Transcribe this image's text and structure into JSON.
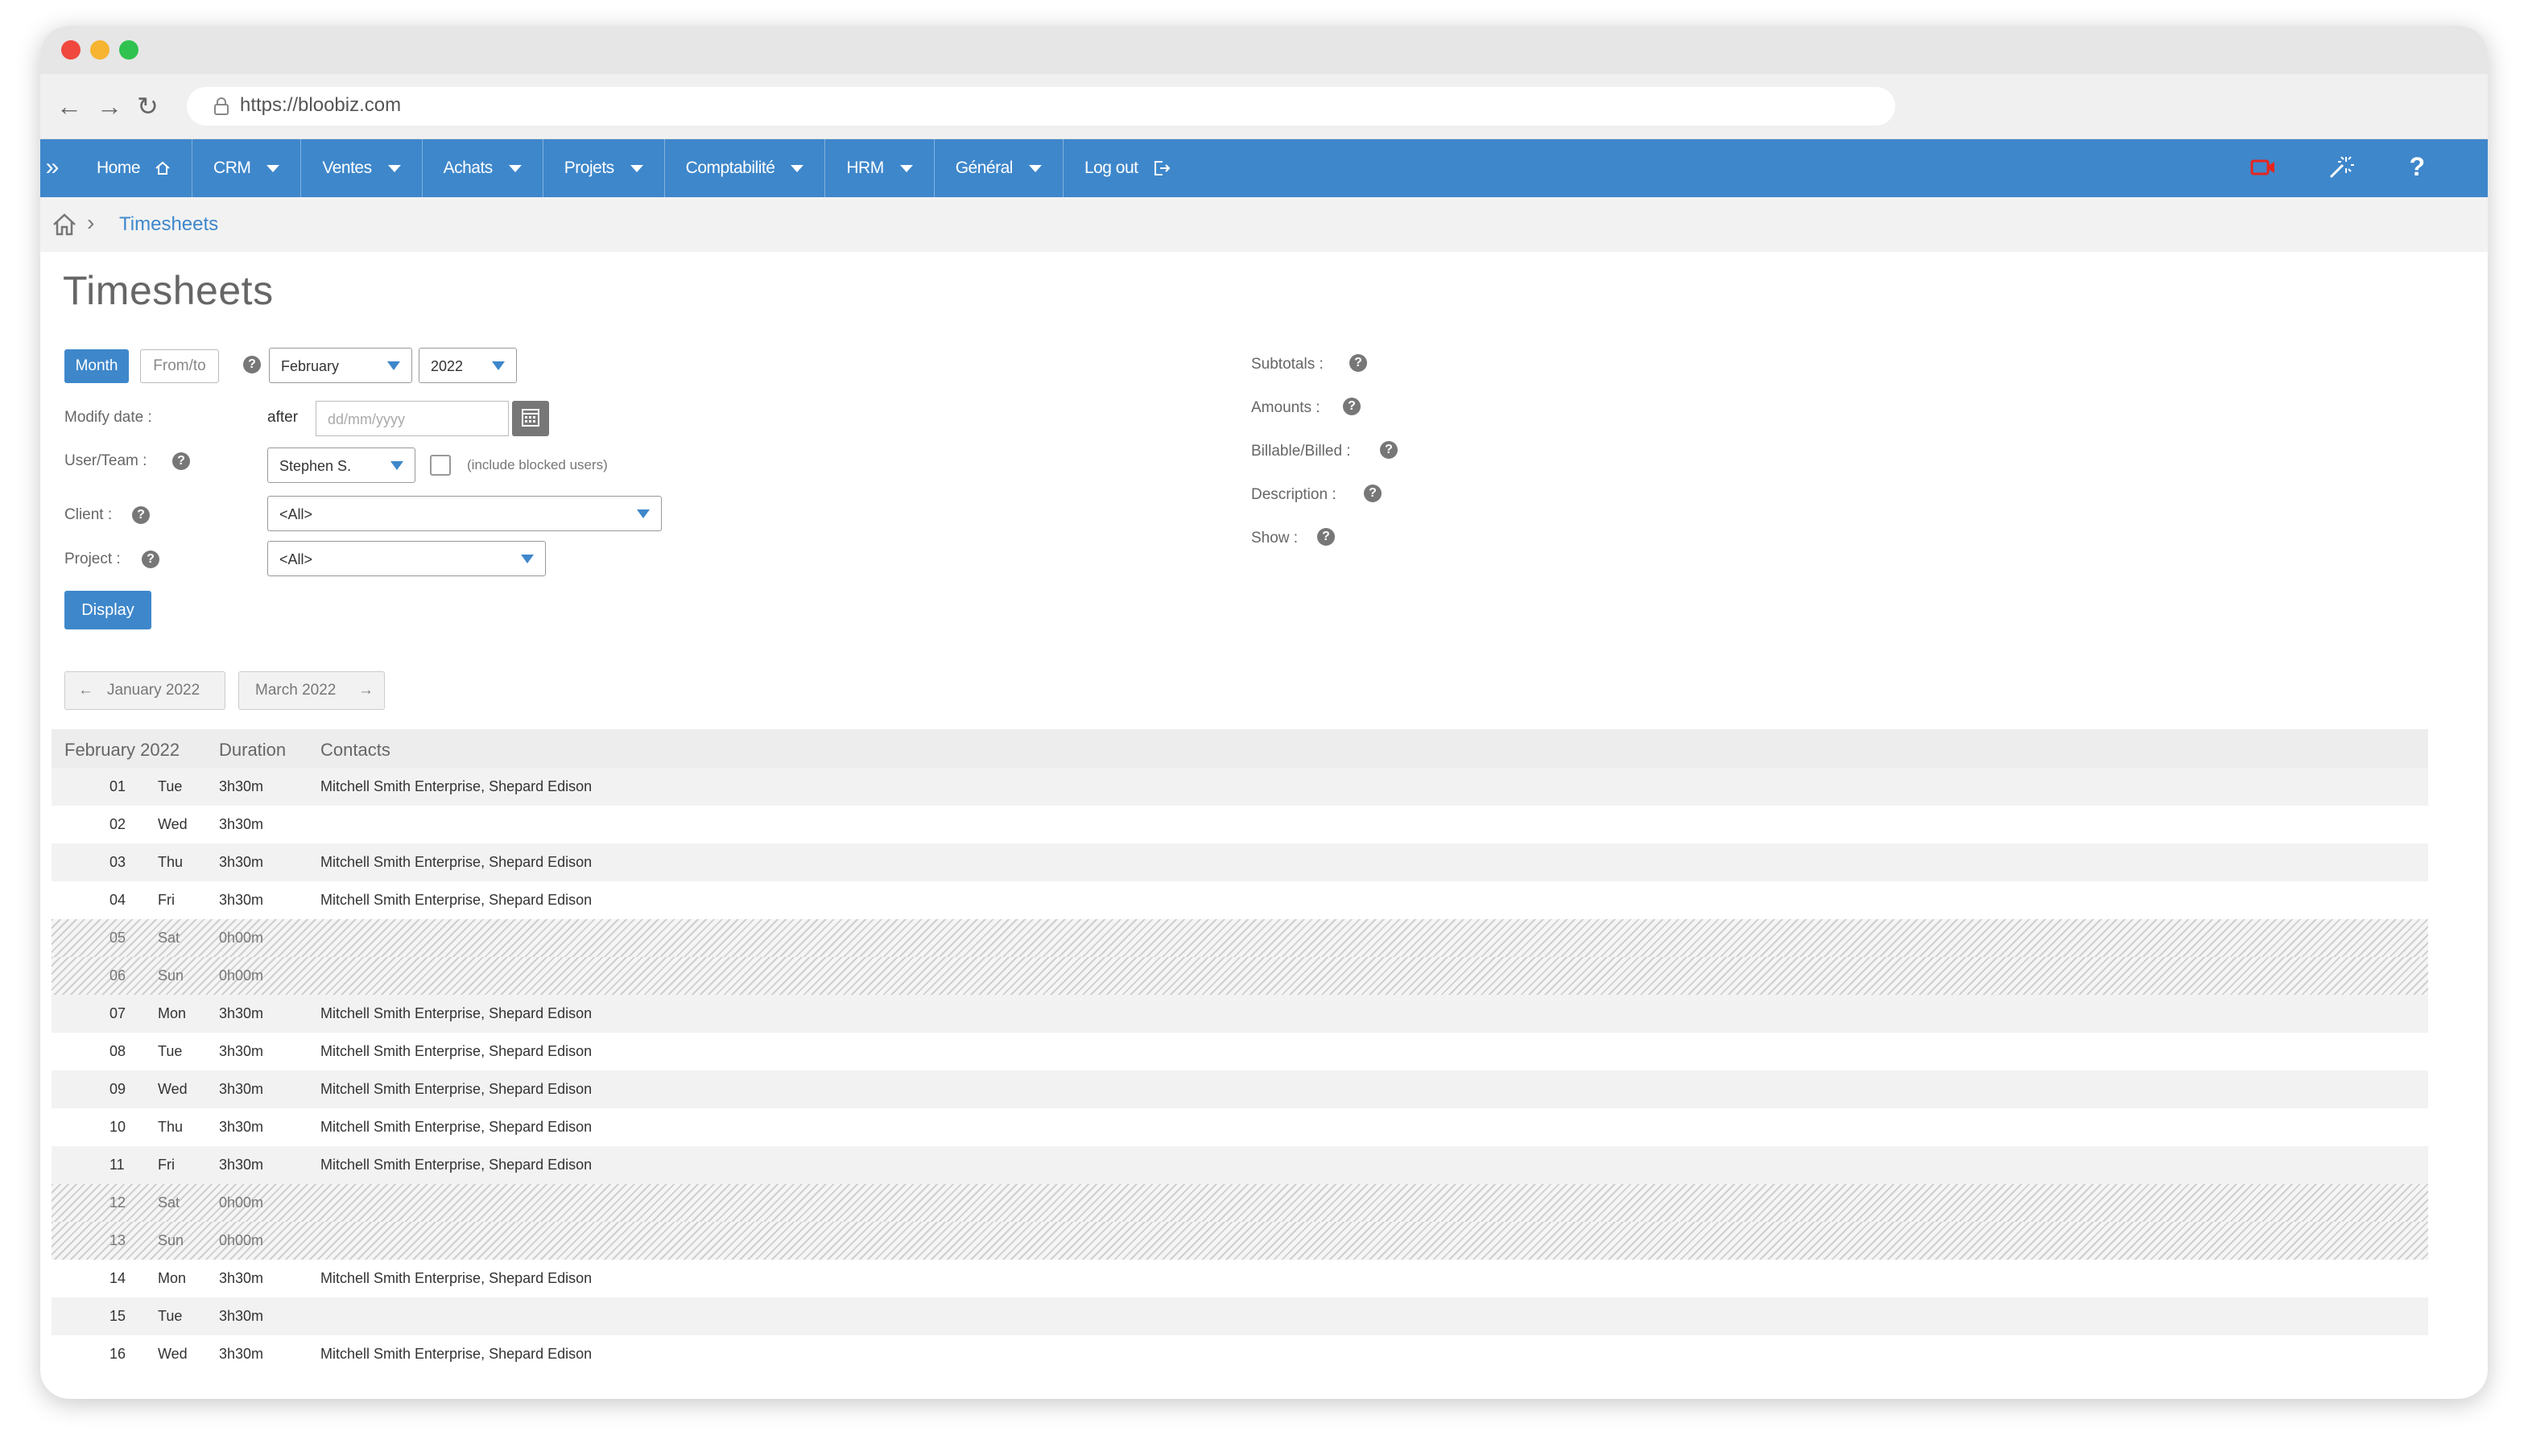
{
  "browser": {
    "url": "https://bloobiz.com"
  },
  "nav": {
    "expand": "»",
    "items": [
      {
        "label": "Home",
        "icon": "home-icon"
      },
      {
        "label": "CRM",
        "caret": true
      },
      {
        "label": "Ventes",
        "caret": true
      },
      {
        "label": "Achats",
        "caret": true
      },
      {
        "label": "Projets",
        "caret": true
      },
      {
        "label": "Comptabilité",
        "caret": true
      },
      {
        "label": "HRM",
        "caret": true
      },
      {
        "label": "Général",
        "caret": true
      },
      {
        "label": "Log out",
        "icon": "logout-icon"
      }
    ],
    "right_icons": [
      "video-icon",
      "magic-wand-icon",
      "help-icon"
    ],
    "help": "?"
  },
  "breadcrumb": {
    "current": "Timesheets"
  },
  "page": {
    "title": "Timesheets"
  },
  "filters": {
    "month_button": "Month",
    "fromto_button": "From/to",
    "month_value": "February",
    "year_value": "2022",
    "modify_date_label": "Modify date :",
    "after_label": "after",
    "date_placeholder": "dd/mm/yyyy",
    "user_label": "User/Team :",
    "user_value": "Stephen S.",
    "include_blocked": "(include blocked users)",
    "client_label": "Client :",
    "client_value": "<All>",
    "project_label": "Project :",
    "project_value": "<All>",
    "display_button": "Display"
  },
  "options": {
    "subtotals": "Subtotals :",
    "amounts": "Amounts :",
    "billable": "Billable/Billed :",
    "description": "Description :",
    "show": "Show :"
  },
  "pager": {
    "prev": "January 2022",
    "next": "March 2022"
  },
  "table": {
    "headers": [
      "February 2022",
      "Duration",
      "Contacts"
    ],
    "rows": [
      {
        "num": "01",
        "day": "Tue",
        "duration": "3h30m",
        "contacts": "Mitchell Smith Enterprise, Shepard Edison"
      },
      {
        "num": "02",
        "day": "Wed",
        "duration": "3h30m",
        "contacts": ""
      },
      {
        "num": "03",
        "day": "Thu",
        "duration": "3h30m",
        "contacts": "Mitchell Smith Enterprise, Shepard Edison"
      },
      {
        "num": "04",
        "day": "Fri",
        "duration": "3h30m",
        "contacts": "Mitchell Smith Enterprise, Shepard Edison"
      },
      {
        "num": "05",
        "day": "Sat",
        "duration": "0h00m",
        "contacts": ""
      },
      {
        "num": "06",
        "day": "Sun",
        "duration": "0h00m",
        "contacts": ""
      },
      {
        "num": "07",
        "day": "Mon",
        "duration": "3h30m",
        "contacts": "Mitchell Smith Enterprise, Shepard Edison"
      },
      {
        "num": "08",
        "day": "Tue",
        "duration": "3h30m",
        "contacts": "Mitchell Smith Enterprise, Shepard Edison"
      },
      {
        "num": "09",
        "day": "Wed",
        "duration": "3h30m",
        "contacts": "Mitchell Smith Enterprise, Shepard Edison"
      },
      {
        "num": "10",
        "day": "Thu",
        "duration": "3h30m",
        "contacts": "Mitchell Smith Enterprise, Shepard Edison"
      },
      {
        "num": "11",
        "day": "Fri",
        "duration": "3h30m",
        "contacts": "Mitchell Smith Enterprise, Shepard Edison"
      },
      {
        "num": "12",
        "day": "Sat",
        "duration": "0h00m",
        "contacts": ""
      },
      {
        "num": "13",
        "day": "Sun",
        "duration": "0h00m",
        "contacts": ""
      },
      {
        "num": "14",
        "day": "Mon",
        "duration": "3h30m",
        "contacts": "Mitchell Smith Enterprise, Shepard Edison"
      },
      {
        "num": "15",
        "day": "Tue",
        "duration": "3h30m",
        "contacts": ""
      },
      {
        "num": "16",
        "day": "Wed",
        "duration": "3h30m",
        "contacts": "Mitchell Smith Enterprise, Shepard Edison"
      }
    ]
  }
}
